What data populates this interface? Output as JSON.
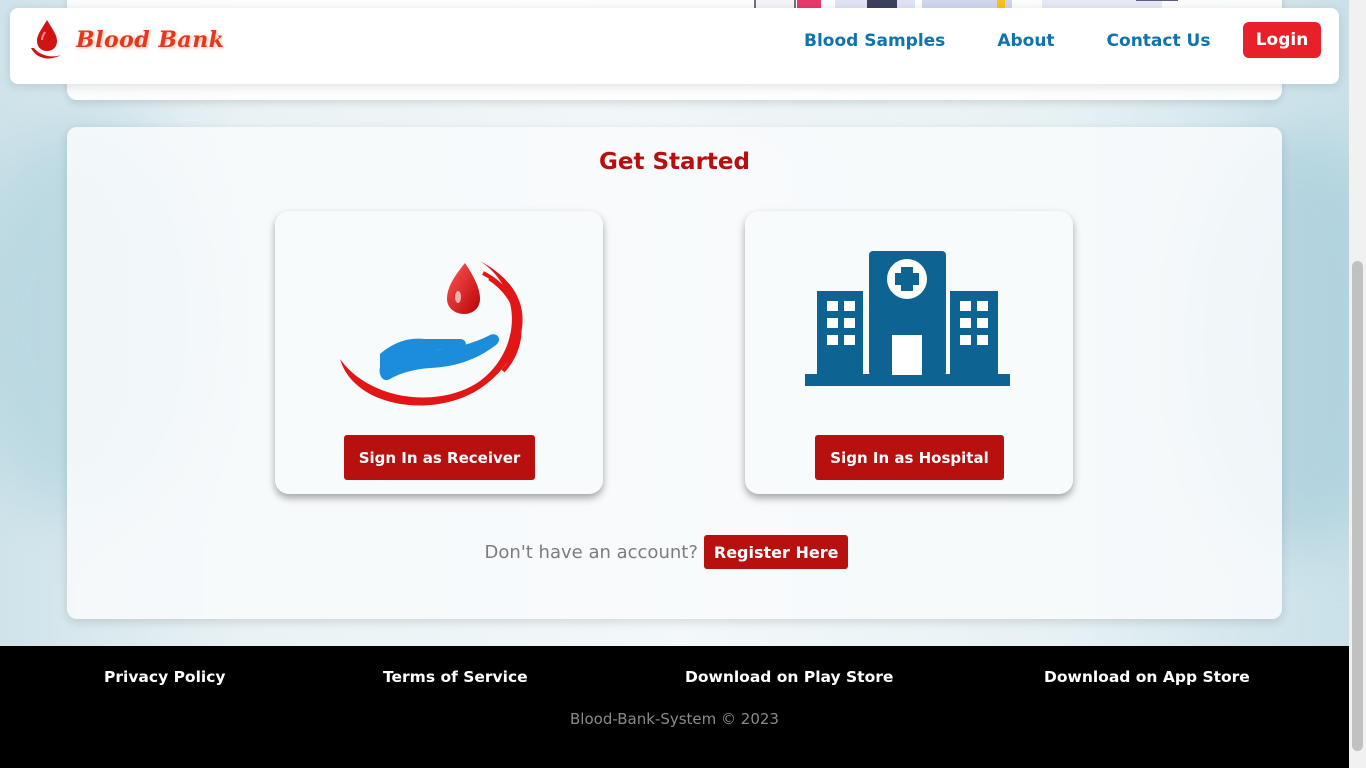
{
  "navbar": {
    "brand": "Blood Bank",
    "links": [
      "Blood Samples",
      "About",
      "Contact Us"
    ],
    "login_label": "Login"
  },
  "main": {
    "title": "Get Started",
    "options": [
      {
        "label": "Sign In as Receiver",
        "icon": "blood-donation-hand-icon"
      },
      {
        "label": "Sign In as Hospital",
        "icon": "hospital-building-icon"
      }
    ],
    "register_question": "Don't have an account?",
    "register_label": "Register Here"
  },
  "footer": {
    "links": [
      "Privacy Policy",
      "Terms of Service",
      "Download on Play Store",
      "Download on App Store"
    ],
    "copyright": "Blood-Bank-System © 2023"
  },
  "colors": {
    "brand_red": "#e8361e",
    "primary_red": "#b80f0f",
    "login_red": "#e8202a",
    "link_blue": "#0f73ad",
    "hospital_blue": "#0d6391"
  }
}
